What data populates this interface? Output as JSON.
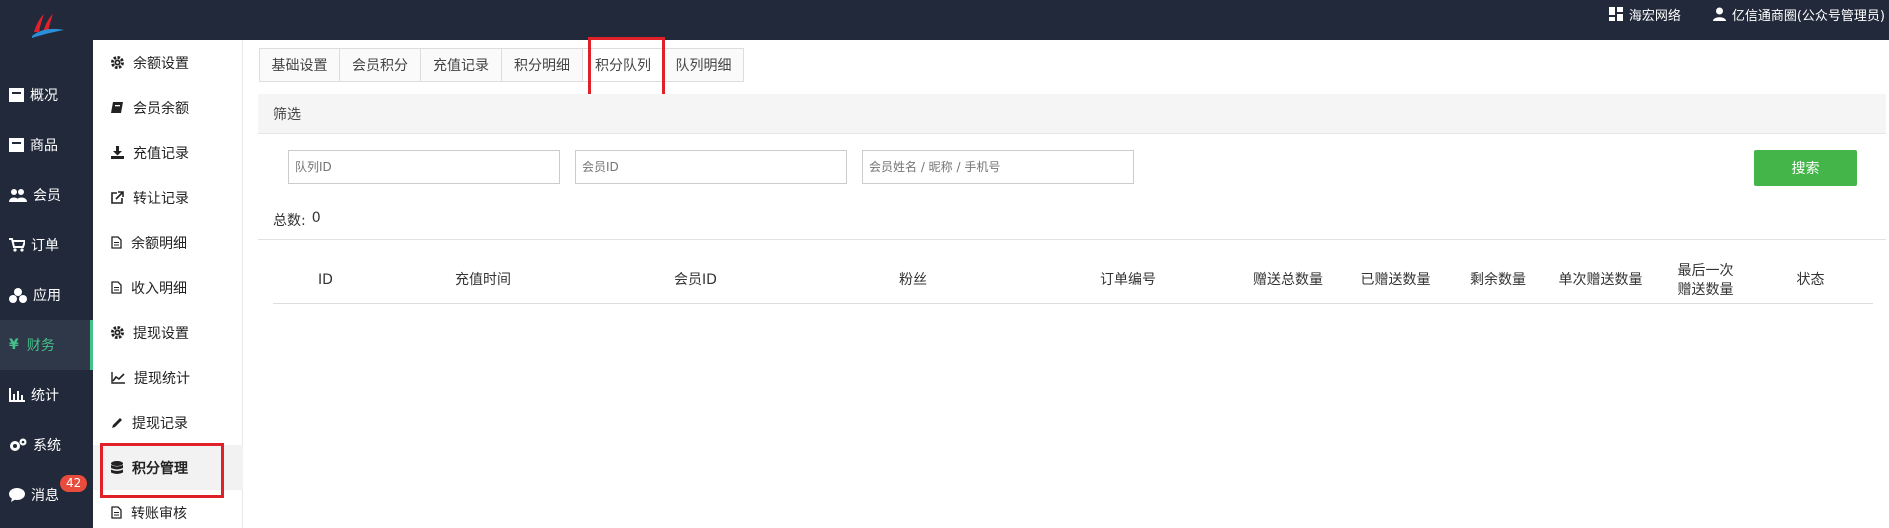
{
  "topbar": {
    "brand_label": "海宏网络",
    "user_label": "亿信通商圈(公众号管理员)"
  },
  "colors": {
    "dark": "#22293a",
    "accent_green": "#44c18a",
    "button_green": "#44b549",
    "highlight_red": "#e0212a",
    "badge_red": "#e74c3c"
  },
  "leftnav": {
    "items": [
      {
        "label": "概况",
        "icon": "dashboard-icon"
      },
      {
        "label": "商品",
        "icon": "box-icon"
      },
      {
        "label": "会员",
        "icon": "users-icon"
      },
      {
        "label": "订单",
        "icon": "cart-icon"
      },
      {
        "label": "应用",
        "icon": "apps-icon"
      },
      {
        "label": "财务",
        "icon": "yen-icon"
      },
      {
        "label": "统计",
        "icon": "bar-chart-icon"
      },
      {
        "label": "系统",
        "icon": "gears-icon"
      },
      {
        "label": "消息",
        "icon": "chat-icon"
      }
    ],
    "message_badge": "42",
    "active": "财务"
  },
  "subnav": {
    "items": [
      {
        "label": "余额设置",
        "icon": "gear-icon"
      },
      {
        "label": "会员余额",
        "icon": "book-icon"
      },
      {
        "label": "充值记录",
        "icon": "download-icon"
      },
      {
        "label": "转让记录",
        "icon": "external-link-icon"
      },
      {
        "label": "余额明细",
        "icon": "file-icon"
      },
      {
        "label": "收入明细",
        "icon": "file-icon"
      },
      {
        "label": "提现设置",
        "icon": "gear-icon"
      },
      {
        "label": "提现统计",
        "icon": "line-chart-icon"
      },
      {
        "label": "提现记录",
        "icon": "pencil-icon"
      },
      {
        "label": "积分管理",
        "icon": "database-icon"
      },
      {
        "label": "转账审核",
        "icon": "file-icon"
      }
    ],
    "active": "积分管理"
  },
  "tabs": [
    {
      "label": "基础设置"
    },
    {
      "label": "会员积分"
    },
    {
      "label": "充值记录"
    },
    {
      "label": "积分明细"
    },
    {
      "label": "积分队列"
    },
    {
      "label": "队列明细"
    }
  ],
  "active_tab": "积分队列",
  "filter": {
    "title": "筛选",
    "queue_id_placeholder": "队列ID",
    "member_id_placeholder": "会员ID",
    "member_query_placeholder": "会员姓名 / 昵称 / 手机号",
    "search_label": "搜索"
  },
  "summary": {
    "total_label": "总数:",
    "total_value": "0"
  },
  "table": {
    "columns": [
      "ID",
      "充值时间",
      "会员ID",
      "粉丝",
      "订单编号",
      "赠送总数量",
      "已赠送数量",
      "剩余数量",
      "单次赠送数量",
      "最后一次\n赠送数量",
      "状态"
    ]
  }
}
